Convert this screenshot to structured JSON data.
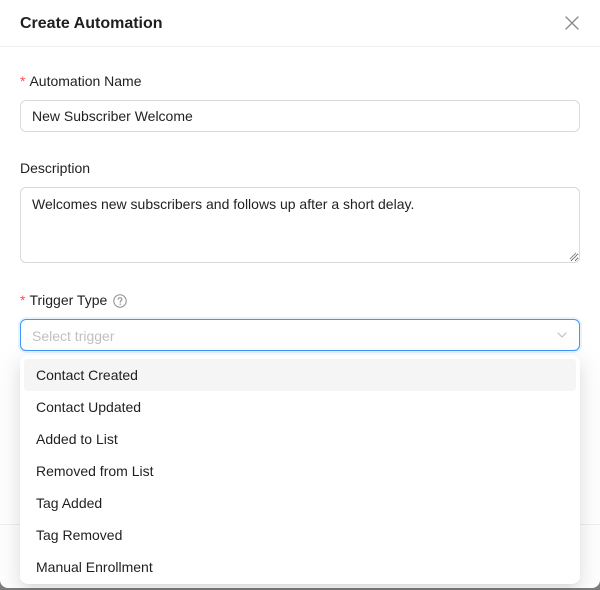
{
  "dialog": {
    "title": "Create Automation",
    "close_icon": "close-icon"
  },
  "form": {
    "name_label": "Automation Name",
    "name_value": "New Subscriber Welcome",
    "name_required": "*",
    "description_label": "Description",
    "description_value": "Welcomes new subscribers and follows up after a short delay.",
    "trigger_label": "Trigger Type",
    "trigger_required": "*",
    "trigger_help_icon": "question-circle-icon",
    "trigger_placeholder": "Select trigger",
    "trigger_arrow_icon": "chevron-down-icon"
  },
  "dropdown": {
    "options": [
      "Contact Created",
      "Contact Updated",
      "Added to List",
      "Removed from List",
      "Tag Added",
      "Tag Removed",
      "Manual Enrollment"
    ],
    "active_index": 0
  },
  "colors": {
    "required": "#ff4d4f",
    "focus_border": "#4096ff",
    "active_option_bg": "#f5f5f5"
  }
}
